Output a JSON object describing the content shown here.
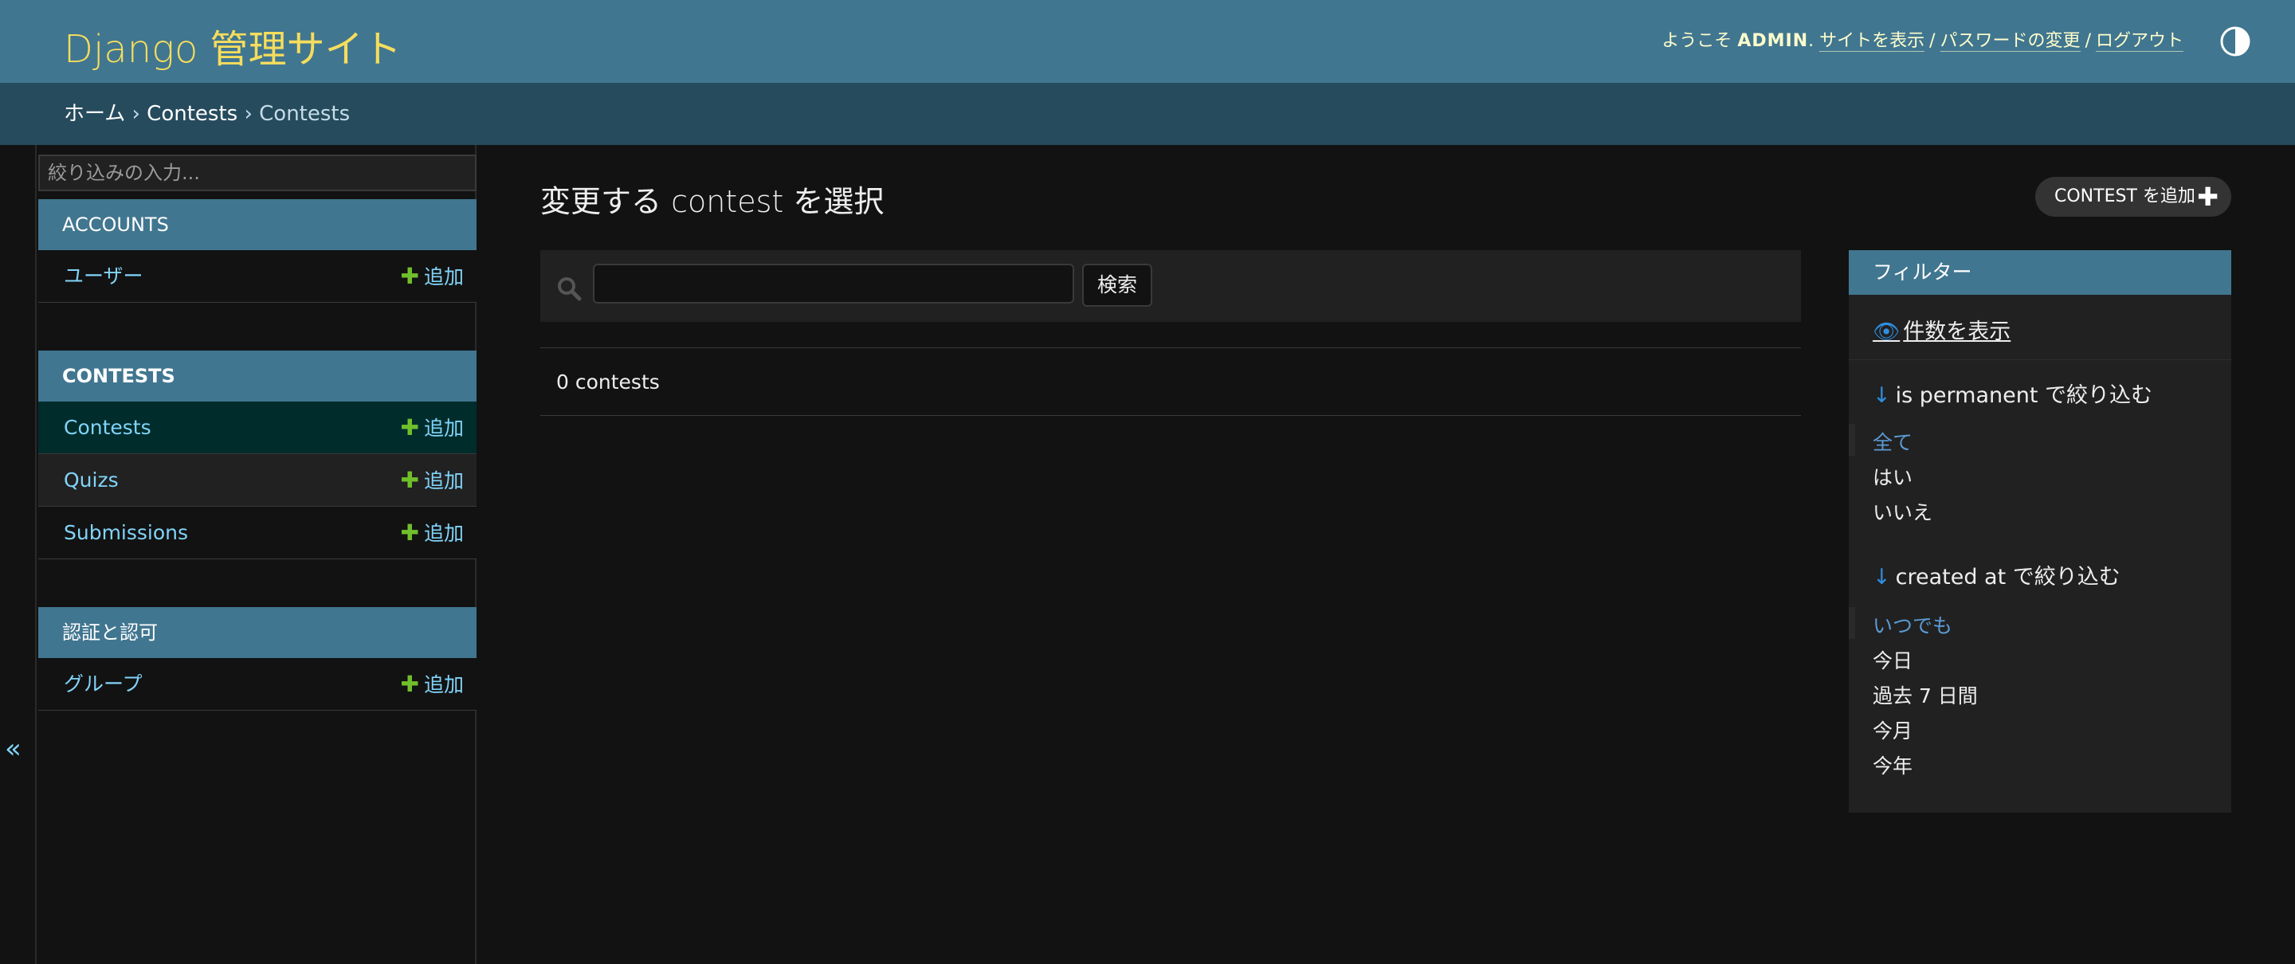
{
  "header": {
    "brand": "Django 管理サイト",
    "welcome": "ようこそ",
    "username": "ADMIN",
    "links": {
      "view_site": "サイトを表示",
      "change_password": "パスワードの変更",
      "logout": "ログアウト"
    },
    "separator": "/",
    "theme_icon": "contrast-icon"
  },
  "breadcrumbs": {
    "home": "ホーム",
    "separator": "›",
    "app": "Contests",
    "current": "Contests"
  },
  "sidebar": {
    "filter_placeholder": "絞り込みの入力...",
    "add_label": "追加",
    "modules": [
      {
        "caption": "ACCOUNTS",
        "rows": [
          {
            "label": "ユーザー"
          }
        ]
      },
      {
        "caption": "CONTESTS",
        "rows": [
          {
            "label": "Contests"
          },
          {
            "label": "Quizs"
          },
          {
            "label": "Submissions"
          }
        ]
      },
      {
        "caption": "認証と認可",
        "rows": [
          {
            "label": "グループ"
          }
        ]
      }
    ],
    "collapse_icon": "double-chevron-left-icon",
    "collapse_glyph": "«"
  },
  "main": {
    "title": "変更する contest を選択",
    "add_button": "CONTEST を追加",
    "search_button": "検索",
    "search_value": "",
    "results": "0 contests"
  },
  "filter": {
    "caption": "フィルター",
    "show_counts": "件数を表示",
    "groups": [
      {
        "heading": "is permanent で絞り込む",
        "choices": [
          "全て",
          "はい",
          "いいえ"
        ]
      },
      {
        "heading": "created at で絞り込む",
        "choices": [
          "いつでも",
          "今日",
          "過去 7 日間",
          "今月",
          "今年"
        ]
      }
    ]
  },
  "colors": {
    "header_bg": "#417690",
    "breadcrumb_bg": "#264b5d",
    "brand": "#f5dd5d",
    "link": "#81d4fa",
    "add_plus": "#70bf2b",
    "page_bg": "#121212",
    "selected_row": "#002c2b"
  }
}
